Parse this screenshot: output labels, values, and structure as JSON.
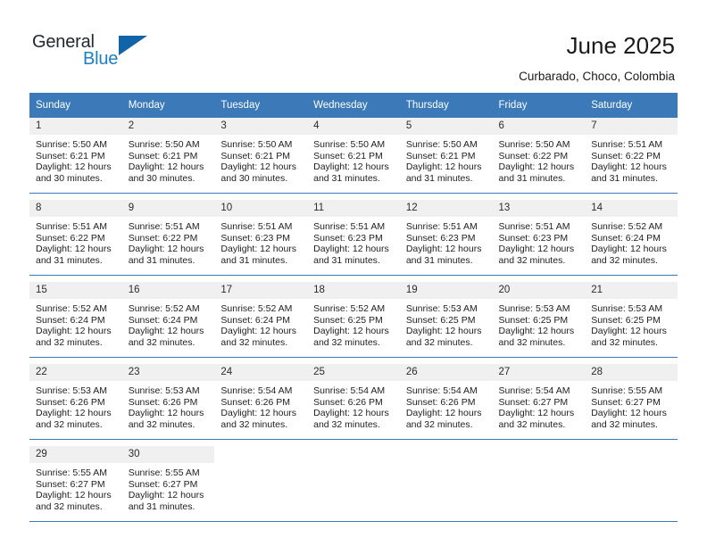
{
  "brand": {
    "name_part1": "General",
    "name_part2": "Blue"
  },
  "header": {
    "title": "June 2025",
    "subtitle": "Curbarado, Choco, Colombia"
  },
  "colors": {
    "header_blue": "#3b79b8",
    "logo_blue": "#1b7fc4",
    "daynum_bg": "#f0f0f0"
  },
  "calendar": {
    "weekday_headers": [
      "Sunday",
      "Monday",
      "Tuesday",
      "Wednesday",
      "Thursday",
      "Friday",
      "Saturday"
    ],
    "weeks": [
      [
        {
          "day": "1",
          "sunrise": "Sunrise: 5:50 AM",
          "sunset": "Sunset: 6:21 PM",
          "daylight_line1": "Daylight: 12 hours",
          "daylight_line2": "and 30 minutes."
        },
        {
          "day": "2",
          "sunrise": "Sunrise: 5:50 AM",
          "sunset": "Sunset: 6:21 PM",
          "daylight_line1": "Daylight: 12 hours",
          "daylight_line2": "and 30 minutes."
        },
        {
          "day": "3",
          "sunrise": "Sunrise: 5:50 AM",
          "sunset": "Sunset: 6:21 PM",
          "daylight_line1": "Daylight: 12 hours",
          "daylight_line2": "and 30 minutes."
        },
        {
          "day": "4",
          "sunrise": "Sunrise: 5:50 AM",
          "sunset": "Sunset: 6:21 PM",
          "daylight_line1": "Daylight: 12 hours",
          "daylight_line2": "and 31 minutes."
        },
        {
          "day": "5",
          "sunrise": "Sunrise: 5:50 AM",
          "sunset": "Sunset: 6:21 PM",
          "daylight_line1": "Daylight: 12 hours",
          "daylight_line2": "and 31 minutes."
        },
        {
          "day": "6",
          "sunrise": "Sunrise: 5:50 AM",
          "sunset": "Sunset: 6:22 PM",
          "daylight_line1": "Daylight: 12 hours",
          "daylight_line2": "and 31 minutes."
        },
        {
          "day": "7",
          "sunrise": "Sunrise: 5:51 AM",
          "sunset": "Sunset: 6:22 PM",
          "daylight_line1": "Daylight: 12 hours",
          "daylight_line2": "and 31 minutes."
        }
      ],
      [
        {
          "day": "8",
          "sunrise": "Sunrise: 5:51 AM",
          "sunset": "Sunset: 6:22 PM",
          "daylight_line1": "Daylight: 12 hours",
          "daylight_line2": "and 31 minutes."
        },
        {
          "day": "9",
          "sunrise": "Sunrise: 5:51 AM",
          "sunset": "Sunset: 6:22 PM",
          "daylight_line1": "Daylight: 12 hours",
          "daylight_line2": "and 31 minutes."
        },
        {
          "day": "10",
          "sunrise": "Sunrise: 5:51 AM",
          "sunset": "Sunset: 6:23 PM",
          "daylight_line1": "Daylight: 12 hours",
          "daylight_line2": "and 31 minutes."
        },
        {
          "day": "11",
          "sunrise": "Sunrise: 5:51 AM",
          "sunset": "Sunset: 6:23 PM",
          "daylight_line1": "Daylight: 12 hours",
          "daylight_line2": "and 31 minutes."
        },
        {
          "day": "12",
          "sunrise": "Sunrise: 5:51 AM",
          "sunset": "Sunset: 6:23 PM",
          "daylight_line1": "Daylight: 12 hours",
          "daylight_line2": "and 31 minutes."
        },
        {
          "day": "13",
          "sunrise": "Sunrise: 5:51 AM",
          "sunset": "Sunset: 6:23 PM",
          "daylight_line1": "Daylight: 12 hours",
          "daylight_line2": "and 32 minutes."
        },
        {
          "day": "14",
          "sunrise": "Sunrise: 5:52 AM",
          "sunset": "Sunset: 6:24 PM",
          "daylight_line1": "Daylight: 12 hours",
          "daylight_line2": "and 32 minutes."
        }
      ],
      [
        {
          "day": "15",
          "sunrise": "Sunrise: 5:52 AM",
          "sunset": "Sunset: 6:24 PM",
          "daylight_line1": "Daylight: 12 hours",
          "daylight_line2": "and 32 minutes."
        },
        {
          "day": "16",
          "sunrise": "Sunrise: 5:52 AM",
          "sunset": "Sunset: 6:24 PM",
          "daylight_line1": "Daylight: 12 hours",
          "daylight_line2": "and 32 minutes."
        },
        {
          "day": "17",
          "sunrise": "Sunrise: 5:52 AM",
          "sunset": "Sunset: 6:24 PM",
          "daylight_line1": "Daylight: 12 hours",
          "daylight_line2": "and 32 minutes."
        },
        {
          "day": "18",
          "sunrise": "Sunrise: 5:52 AM",
          "sunset": "Sunset: 6:25 PM",
          "daylight_line1": "Daylight: 12 hours",
          "daylight_line2": "and 32 minutes."
        },
        {
          "day": "19",
          "sunrise": "Sunrise: 5:53 AM",
          "sunset": "Sunset: 6:25 PM",
          "daylight_line1": "Daylight: 12 hours",
          "daylight_line2": "and 32 minutes."
        },
        {
          "day": "20",
          "sunrise": "Sunrise: 5:53 AM",
          "sunset": "Sunset: 6:25 PM",
          "daylight_line1": "Daylight: 12 hours",
          "daylight_line2": "and 32 minutes."
        },
        {
          "day": "21",
          "sunrise": "Sunrise: 5:53 AM",
          "sunset": "Sunset: 6:25 PM",
          "daylight_line1": "Daylight: 12 hours",
          "daylight_line2": "and 32 minutes."
        }
      ],
      [
        {
          "day": "22",
          "sunrise": "Sunrise: 5:53 AM",
          "sunset": "Sunset: 6:26 PM",
          "daylight_line1": "Daylight: 12 hours",
          "daylight_line2": "and 32 minutes."
        },
        {
          "day": "23",
          "sunrise": "Sunrise: 5:53 AM",
          "sunset": "Sunset: 6:26 PM",
          "daylight_line1": "Daylight: 12 hours",
          "daylight_line2": "and 32 minutes."
        },
        {
          "day": "24",
          "sunrise": "Sunrise: 5:54 AM",
          "sunset": "Sunset: 6:26 PM",
          "daylight_line1": "Daylight: 12 hours",
          "daylight_line2": "and 32 minutes."
        },
        {
          "day": "25",
          "sunrise": "Sunrise: 5:54 AM",
          "sunset": "Sunset: 6:26 PM",
          "daylight_line1": "Daylight: 12 hours",
          "daylight_line2": "and 32 minutes."
        },
        {
          "day": "26",
          "sunrise": "Sunrise: 5:54 AM",
          "sunset": "Sunset: 6:26 PM",
          "daylight_line1": "Daylight: 12 hours",
          "daylight_line2": "and 32 minutes."
        },
        {
          "day": "27",
          "sunrise": "Sunrise: 5:54 AM",
          "sunset": "Sunset: 6:27 PM",
          "daylight_line1": "Daylight: 12 hours",
          "daylight_line2": "and 32 minutes."
        },
        {
          "day": "28",
          "sunrise": "Sunrise: 5:55 AM",
          "sunset": "Sunset: 6:27 PM",
          "daylight_line1": "Daylight: 12 hours",
          "daylight_line2": "and 32 minutes."
        }
      ],
      [
        {
          "day": "29",
          "sunrise": "Sunrise: 5:55 AM",
          "sunset": "Sunset: 6:27 PM",
          "daylight_line1": "Daylight: 12 hours",
          "daylight_line2": "and 32 minutes."
        },
        {
          "day": "30",
          "sunrise": "Sunrise: 5:55 AM",
          "sunset": "Sunset: 6:27 PM",
          "daylight_line1": "Daylight: 12 hours",
          "daylight_line2": "and 31 minutes."
        },
        {
          "day": "",
          "sunrise": "",
          "sunset": "",
          "daylight_line1": "",
          "daylight_line2": ""
        },
        {
          "day": "",
          "sunrise": "",
          "sunset": "",
          "daylight_line1": "",
          "daylight_line2": ""
        },
        {
          "day": "",
          "sunrise": "",
          "sunset": "",
          "daylight_line1": "",
          "daylight_line2": ""
        },
        {
          "day": "",
          "sunrise": "",
          "sunset": "",
          "daylight_line1": "",
          "daylight_line2": ""
        },
        {
          "day": "",
          "sunrise": "",
          "sunset": "",
          "daylight_line1": "",
          "daylight_line2": ""
        }
      ]
    ]
  }
}
